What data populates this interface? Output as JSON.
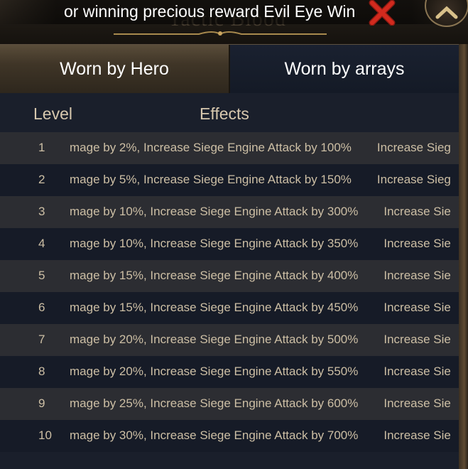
{
  "panel": {
    "title_ghost": "Tactic Blood"
  },
  "marquee": {
    "text": "or winning precious reward Evil Eye Win"
  },
  "tabs": [
    {
      "label": "Worn by Hero",
      "active": true
    },
    {
      "label": "Worn by arrays",
      "active": false
    }
  ],
  "table": {
    "headers": {
      "level": "Level",
      "effects": "Effects"
    },
    "rows": [
      {
        "level": "1",
        "effect": "mage by 2%,  Increase Siege Engine Attack by 100%",
        "tail": "Increase Sieg"
      },
      {
        "level": "2",
        "effect": "mage by 5%,  Increase Siege Engine Attack by 150%",
        "tail": "Increase Sieg"
      },
      {
        "level": "3",
        "effect": "mage by 10%,  Increase Siege Engine Attack by 300%",
        "tail": "Increase Sie"
      },
      {
        "level": "4",
        "effect": "mage by 10%,  Increase Siege Engine Attack by 350%",
        "tail": "Increase Sie"
      },
      {
        "level": "5",
        "effect": "mage by 15%,  Increase Siege Engine Attack by 400%",
        "tail": "Increase Sie"
      },
      {
        "level": "6",
        "effect": "mage by 15%,  Increase Siege Engine Attack by 450%",
        "tail": "Increase Sie"
      },
      {
        "level": "7",
        "effect": "mage by 20%,  Increase Siege Engine Attack by 500%",
        "tail": "Increase Sie"
      },
      {
        "level": "8",
        "effect": "mage by 20%,  Increase Siege Engine Attack by 550%",
        "tail": "Increase Sie"
      },
      {
        "level": "9",
        "effect": "mage by 25%,  Increase Siege Engine Attack by 600%",
        "tail": "Increase Sie"
      },
      {
        "level": "10",
        "effect": "mage by 30%,  Increase Siege Engine Attack by 700%",
        "tail": "Increase Sie"
      }
    ]
  },
  "icons": {
    "close": "close-x-icon",
    "collapse": "chevron-up-icon",
    "ornament": "gold-ornament-icon"
  },
  "colors": {
    "close_red": "#d22a1e",
    "text_beige": "#cdbfa5",
    "row_light": "#2c2d32",
    "row_dark": "#161b27"
  }
}
